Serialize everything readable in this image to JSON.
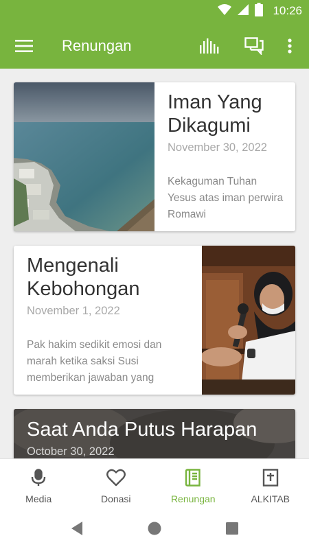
{
  "status_bar": {
    "time": "10:26",
    "icons": [
      "wifi-icon",
      "signal-icon",
      "battery-icon"
    ]
  },
  "app_bar": {
    "title": "Renungan",
    "actions": [
      "stats-icon",
      "chat-icon",
      "more-vert-icon"
    ]
  },
  "colors": {
    "primary": "#78b43e",
    "title_text": "#333333",
    "date_text": "#a8a8a8",
    "excerpt_text": "#8a8a8a"
  },
  "cards": [
    {
      "title": "Iman Yang Dikagumi O...",
      "date": "November 30, 2022",
      "excerpt": "Kekaguman Tuhan Yesus atas iman perwira Romawi",
      "image": "coastal-town-sea-photo"
    },
    {
      "title": "Mengenali Kebohongan",
      "date": "November 1, 2022",
      "excerpt": "Pak hakim sedikit emosi dan marah ketika saksi Susi memberikan jawaban yang",
      "image": "woman-in-hijab-speaking-at-microphone-photo"
    },
    {
      "title": "Saat Anda Putus Harapan",
      "date": "October 30, 2022",
      "image": "dark-background-photo"
    }
  ],
  "bottom_nav": [
    {
      "label": "Media",
      "icon": "mic-icon",
      "active": false
    },
    {
      "label": "Donasi",
      "icon": "heart-icon",
      "active": false
    },
    {
      "label": "Renungan",
      "icon": "book-icon",
      "active": true
    },
    {
      "label": "ALKITAB",
      "icon": "bible-icon",
      "active": false
    }
  ],
  "system_nav": [
    "back-icon",
    "home-icon",
    "recents-icon"
  ]
}
